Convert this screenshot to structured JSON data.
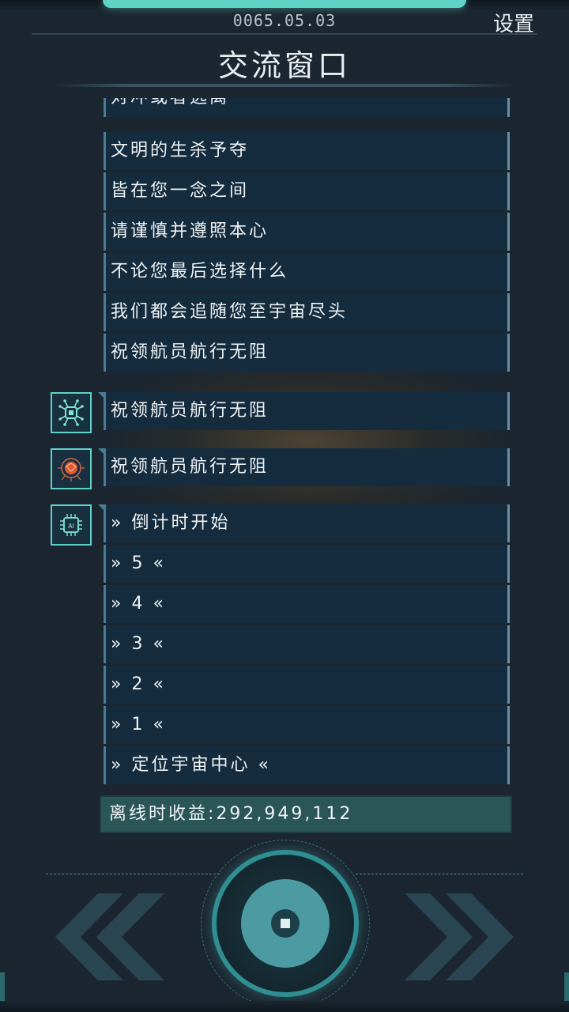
{
  "header": {
    "date": "0065.05.03",
    "settings_label": "设置",
    "title": "交流窗口"
  },
  "messages_top": [
    "对冲或者逃离",
    "文明的生杀予夺",
    "皆在您一念之间",
    "请谨慎并遵照本心",
    "不论您最后选择什么",
    "我们都会追随您至宇宙尽头",
    "祝领航员航行无阻"
  ],
  "reply_a": {
    "avatar": "cyber-chip-icon",
    "text": "祝领航员航行无阻"
  },
  "reply_b": {
    "avatar": "brain-circuit-icon",
    "text": "祝领航员航行无阻"
  },
  "countdown": {
    "avatar": "ai-chip-icon",
    "lines": [
      "» 倒计时开始",
      "» 5 «",
      "» 4 «",
      "» 3 «",
      "» 2 «",
      "» 1 «",
      "» 定位宇宙中心 «"
    ]
  },
  "earnings": {
    "text": "离线时收益:292,949,112"
  },
  "controls": {
    "prev": "double-chevron-left-icon",
    "center": "core-button",
    "next": "double-chevron-right-icon"
  },
  "colors": {
    "accent": "#5fd3c6",
    "bubble": "#142c3e",
    "earnings_bg": "#2a5655"
  }
}
